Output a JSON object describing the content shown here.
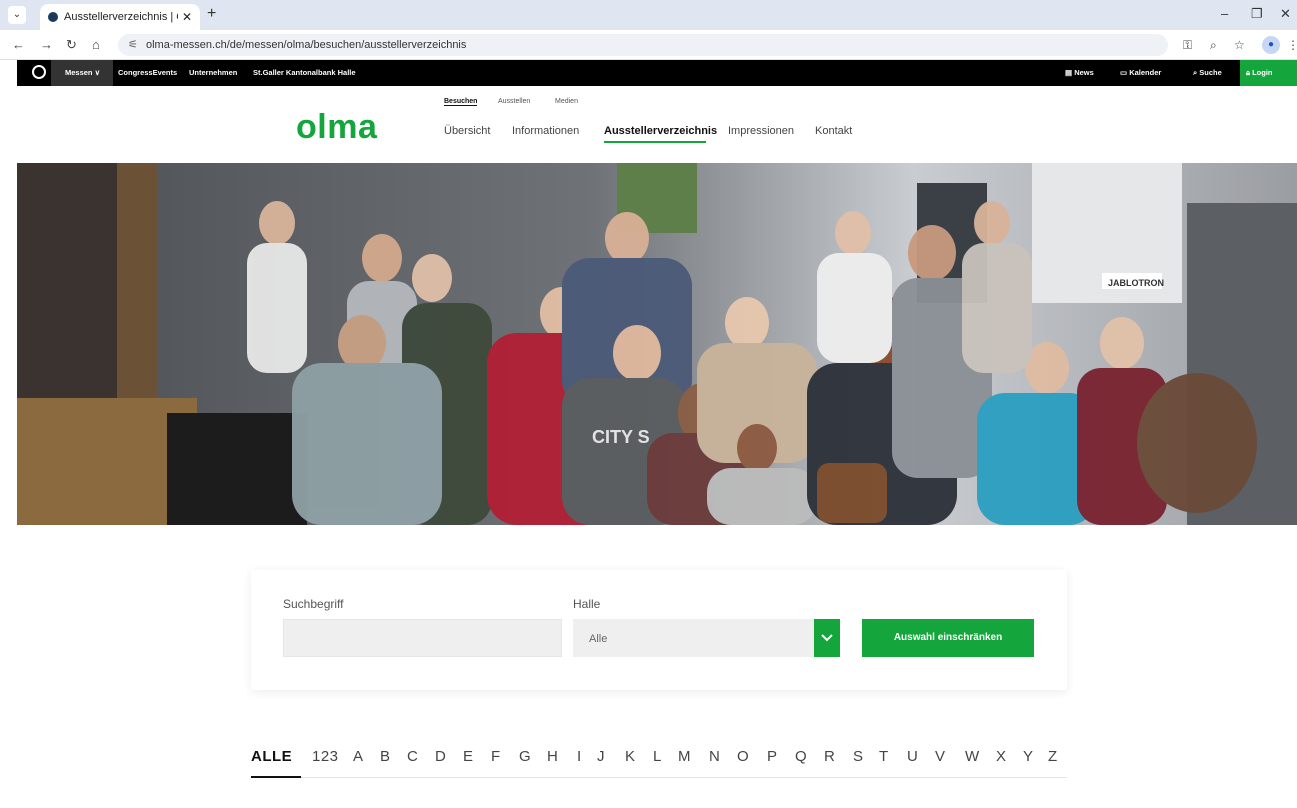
{
  "browser": {
    "tab_title": "Ausstellerverzeichnis | OLMA S...",
    "url": "olma-messen.ch/de/messen/olma/besuchen/ausstellerverzeichnis"
  },
  "topnav": {
    "messen": "Messen ∨",
    "items": [
      "CongressEvents",
      "Unternehmen",
      "St.Galler Kantonalbank Halle"
    ],
    "news": "News",
    "kalender": "Kalender",
    "suche": "Suche",
    "login": "Login"
  },
  "site": {
    "logo": "olma",
    "subnav": [
      "Besuchen",
      "Ausstellen",
      "Medien"
    ],
    "mainnav": [
      "Übersicht",
      "Informationen",
      "Ausstellerverzeichnis",
      "Impressionen",
      "Kontakt"
    ]
  },
  "hero": {
    "sign": "JABLOTRON",
    "shirt": "CITY S"
  },
  "filter": {
    "search_label": "Suchbegriff",
    "search_value": "",
    "halle_label": "Halle",
    "halle_value": "Alle",
    "submit": "Auswahl einschränken"
  },
  "alphabet": [
    "ALLE",
    "123",
    "A",
    "B",
    "C",
    "D",
    "E",
    "F",
    "G",
    "H",
    "I",
    "J",
    "K",
    "L",
    "M",
    "N",
    "O",
    "P",
    "Q",
    "R",
    "S",
    "T",
    "U",
    "V",
    "W",
    "X",
    "Y",
    "Z"
  ],
  "colors": {
    "brand_green": "#14a53c",
    "topnav_bg": "#000000"
  }
}
